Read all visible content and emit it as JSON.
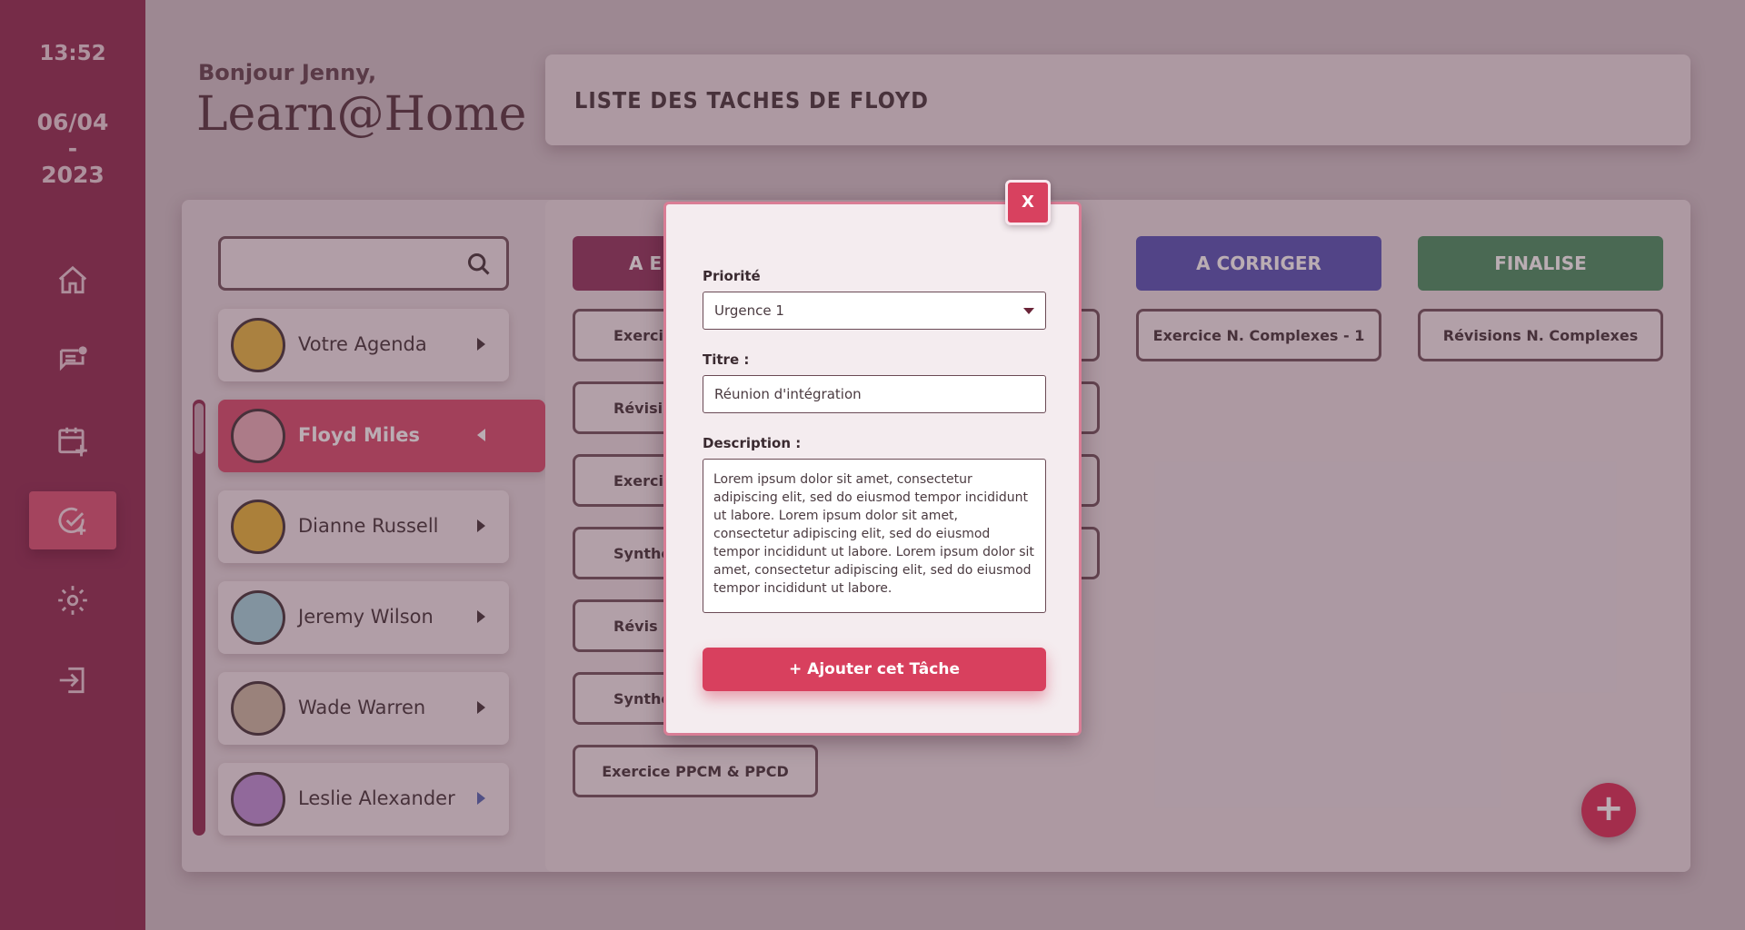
{
  "sidebar": {
    "time": "13:52",
    "date_day": "06/04",
    "date_sep": "-",
    "date_year": "2023",
    "nav": [
      "home-icon",
      "messages-icon",
      "calendar-add-icon",
      "task-add-icon",
      "gear-icon",
      "logout-icon"
    ],
    "active": "task-add-icon"
  },
  "header": {
    "greeting": "Bonjour Jenny,",
    "brand": "Learn@Home",
    "title": "LISTE DES TACHES DE FLOYD"
  },
  "people": [
    {
      "name": "Votre Agenda"
    },
    {
      "name": "Floyd Miles"
    },
    {
      "name": "Dianne Russell"
    },
    {
      "name": "Jeremy Wilson"
    },
    {
      "name": "Wade Warren"
    },
    {
      "name": "Leslie Alexander"
    }
  ],
  "columns": [
    {
      "label": "A E",
      "color": "#8a2a55"
    },
    {
      "label": "A CORRIGER",
      "color": "#4d4bb3"
    },
    {
      "label": "FINALISE",
      "color": "#3f8a5a"
    }
  ],
  "tasks": {
    "col1": [
      "Exerci",
      "Révisi",
      "Exerci",
      "Synthè",
      "Révis",
      "Synthè",
      "Exercice PPCM & PPCD"
    ],
    "col3": [
      "Exercice N. Complexes - 1"
    ],
    "col4": [
      "Révisions N. Complexes"
    ]
  },
  "modal": {
    "close_label": "X",
    "priority_label": "Priorité",
    "priority_value": "Urgence 1",
    "title_label": "Titre :",
    "title_value": "Réunion d'intégration",
    "description_label": "Description :",
    "description_value": "Lorem ipsum dolor sit amet, consectetur adipiscing elit, sed do eiusmod tempor incididunt ut labore. Lorem ipsum dolor sit amet, consectetur adipiscing elit, sed do eiusmod tempor incididunt ut labore. Lorem ipsum dolor sit amet, consectetur adipiscing elit, sed do eiusmod tempor incididunt ut labore.",
    "submit_label": "+ Ajouter cet Tâche"
  },
  "fab_label": "+"
}
